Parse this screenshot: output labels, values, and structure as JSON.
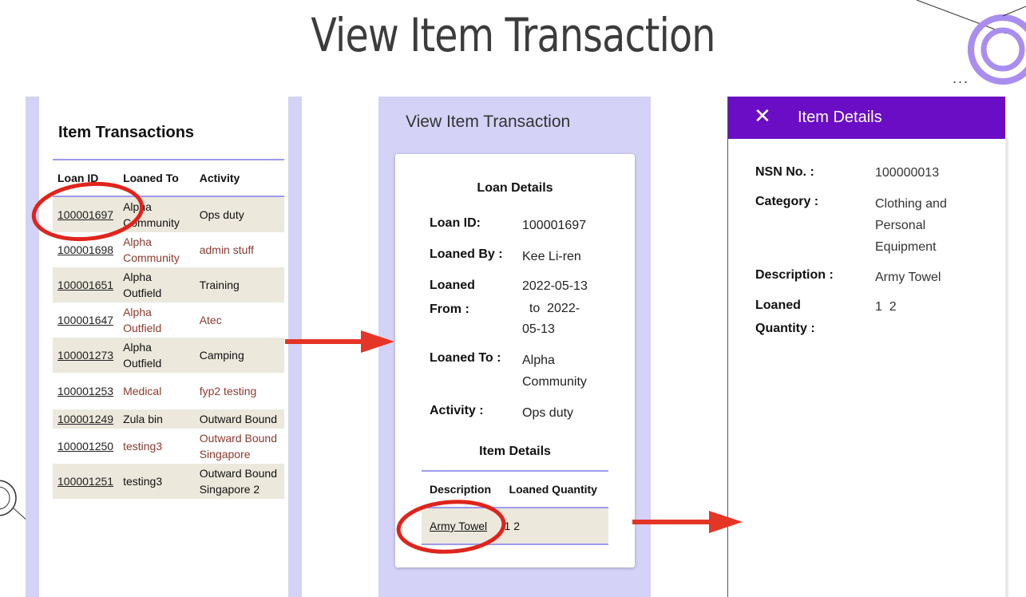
{
  "slide_title": "View Item Transaction",
  "ellipsis": "...",
  "panel1": {
    "heading": "Item Transactions",
    "columns": [
      "Loan ID",
      "Loaned To",
      "Activity"
    ],
    "rows": [
      {
        "id": "100001697",
        "to": "Alpha Community",
        "activity": "Ops duty"
      },
      {
        "id": "100001698",
        "to": "Alpha Community",
        "activity": "admin stuff"
      },
      {
        "id": "100001651",
        "to": "Alpha Outfield",
        "activity": "Training"
      },
      {
        "id": "100001647",
        "to": "Alpha Outfield",
        "activity": "Atec"
      },
      {
        "id": "100001273",
        "to": "Alpha Outfield",
        "activity": "Camping"
      },
      {
        "id": "100001253",
        "to": "Medical",
        "activity": "fyp2 testing"
      },
      {
        "id": "100001249",
        "to": "Zula bin",
        "activity": "Outward Bound"
      },
      {
        "id": "100001250",
        "to": "testing3",
        "activity": "Outward Bound Singapore"
      },
      {
        "id": "100001251",
        "to": "testing3",
        "activity": "Outward Bound Singapore 2"
      }
    ]
  },
  "panel2": {
    "header": "View Item Transaction",
    "loan_section": "Loan Details",
    "loan_id_label": "Loan ID:",
    "loan_id": "100001697",
    "loaned_by_label": "Loaned By :",
    "loaned_by": "Kee Li-ren",
    "loaned_from_label_1": "Loaned",
    "loaned_from_label_2": "From :",
    "loaned_from_1": "2022-05-13",
    "loaned_from_2": "  to  2022-",
    "loaned_from_3": "05-13",
    "loaned_to_label": "Loaned To :",
    "loaned_to_1": "Alpha",
    "loaned_to_2": "Community",
    "activity_label": "Activity :",
    "activity": "Ops duty",
    "item_section": "Item Details",
    "item_columns": [
      "Description",
      "Loaned Quantity"
    ],
    "item_rows": [
      {
        "description": "Army Towel",
        "quantity": "1 2"
      }
    ]
  },
  "panel3": {
    "title": "Item Details",
    "close_icon": "✕",
    "nsn_label": "NSN No. :",
    "nsn": "100000013",
    "category_label": "Category :",
    "category_1": "Clothing and",
    "category_2": "Personal",
    "category_3": "Equipment",
    "description_label": "Description :",
    "description": "Army Towel",
    "quantity_label_1": "Loaned",
    "quantity_label_2": "Quantity :",
    "quantity": "1  2"
  },
  "colors": {
    "accent": "#6a0dc4",
    "panel_bg": "#d4d2f7",
    "row_bg": "#ece8dc",
    "arrow": "#e53526",
    "circle": "#e0241b"
  }
}
